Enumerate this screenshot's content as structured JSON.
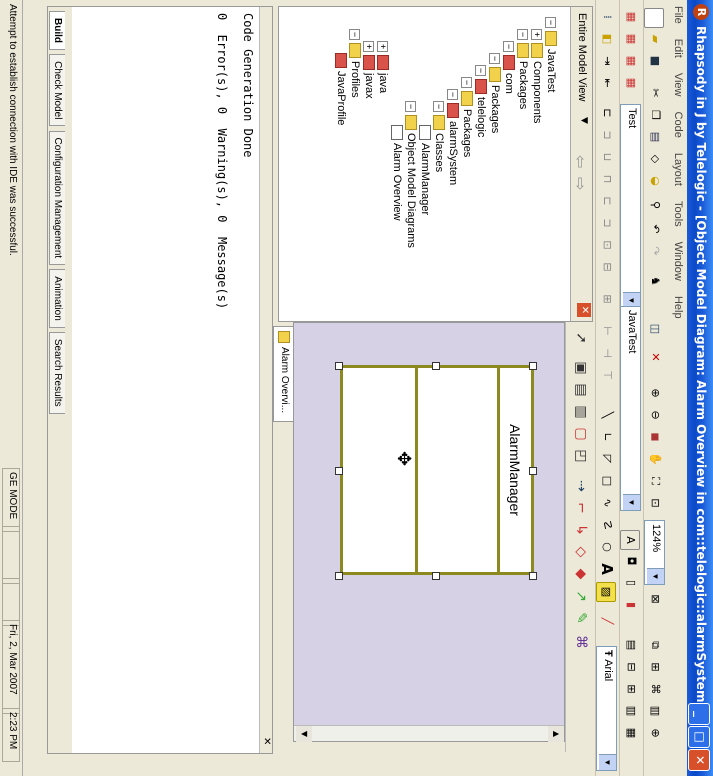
{
  "window": {
    "title": "Rhapsody in J by Telelogic - [Object Model Diagram: Alarm Overview in com::telelogic::alarmSystem *]"
  },
  "menu": [
    "File",
    "Edit",
    "View",
    "Code",
    "Layout",
    "Tools",
    "Window",
    "Help"
  ],
  "toolbar": {
    "project_combo": "Test",
    "component_combo": "JavaTest",
    "zoom_combo": "124%",
    "font_combo": "Arial"
  },
  "browser": {
    "view_combo": "Entire Model View",
    "tree": [
      {
        "label": "JavaTest",
        "icon": "project"
      },
      {
        "label": "Components",
        "icon": "folder"
      },
      {
        "label": "Packages",
        "icon": "folder"
      },
      {
        "label": "com",
        "icon": "package"
      },
      {
        "label": "Packages",
        "icon": "folder"
      },
      {
        "label": "telelogic",
        "icon": "package"
      },
      {
        "label": "Packages",
        "icon": "folder"
      },
      {
        "label": "alarmSystem",
        "icon": "package"
      },
      {
        "label": "Classes",
        "icon": "folder"
      },
      {
        "label": "AlarmManager",
        "icon": "class"
      },
      {
        "label": "Object Model Diagrams",
        "icon": "folder"
      },
      {
        "label": "Alarm Overview",
        "icon": "diagram"
      },
      {
        "label": "java",
        "icon": "package"
      },
      {
        "label": "javax",
        "icon": "package"
      },
      {
        "label": "Profiles",
        "icon": "folder"
      },
      {
        "label": "JavaProfile",
        "icon": "profile"
      }
    ]
  },
  "diagram": {
    "tab_label": "Alarm Overvi...",
    "class_name": "AlarmManager"
  },
  "output": {
    "lines": [
      "Code Generation Done",
      "0  Error(s), 0  Warning(s), 0  Message(s)"
    ],
    "tabs": [
      "Build",
      "Check Model",
      "Configuration Management",
      "Animation",
      "Search Results"
    ]
  },
  "status": {
    "message": "Attempt to establish connection with IDE was successful.",
    "mode": "GE MODE",
    "date": "Fri, 2, Mar 2007",
    "time": "2:23 PM"
  }
}
